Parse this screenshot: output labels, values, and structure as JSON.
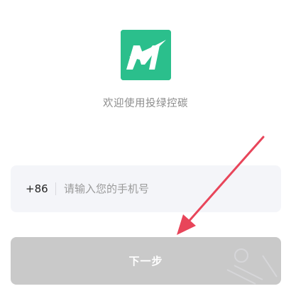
{
  "welcome_text": "欢迎使用投绿控碳",
  "phone": {
    "country_code": "+86",
    "placeholder": "请输入您的手机号",
    "value": ""
  },
  "next_button": {
    "label": "下一步"
  },
  "colors": {
    "brand": "#2bbf8c",
    "button_disabled": "#c9c9c9",
    "input_background": "#f4f5f9",
    "annotation_arrow": "#e8455a"
  },
  "icons": {
    "logo": "app-logo-icon",
    "arrow": "annotation-arrow-icon"
  }
}
